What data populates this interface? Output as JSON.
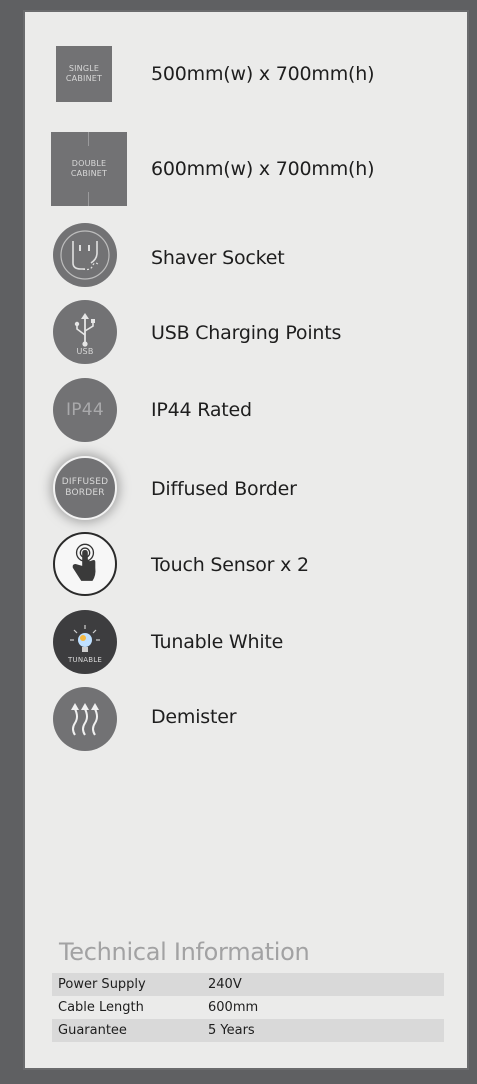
{
  "features": [
    {
      "icon_text": "SINGLE CABINET",
      "icon_name": "single-cabinet-icon",
      "label": "500mm(w) x 700mm(h)"
    },
    {
      "icon_text": "DOUBLE CABINET",
      "icon_name": "double-cabinet-icon",
      "label": "600mm(w) x 700mm(h)"
    },
    {
      "icon_text": "",
      "icon_name": "shaver-socket-icon",
      "label": "Shaver Socket"
    },
    {
      "icon_text": "USB",
      "icon_name": "usb-icon",
      "label": "USB Charging Points"
    },
    {
      "icon_text": "IP44",
      "icon_name": "ip44-icon",
      "label": "IP44 Rated"
    },
    {
      "icon_text": "DIFFUSED BORDER",
      "icon_name": "diffused-border-icon",
      "label": "Diffused Border"
    },
    {
      "icon_text": "",
      "icon_name": "touch-sensor-icon",
      "label": "Touch Sensor x 2"
    },
    {
      "icon_text": "TUNABLE",
      "icon_name": "tunable-white-icon",
      "label": "Tunable White"
    },
    {
      "icon_text": "",
      "icon_name": "demister-icon",
      "label": "Demister"
    }
  ],
  "technical": {
    "title": "Technical Information",
    "rows": [
      {
        "label": "Power Supply",
        "value": "240V"
      },
      {
        "label": "Cable Length",
        "value": "600mm"
      },
      {
        "label": "Guarantee",
        "value": "5 Years"
      }
    ]
  },
  "colors": {
    "page_background": "#5f6062",
    "panel_background": "#ebebea",
    "icon_fill": "#727274",
    "table_shade": "#d9d9d9"
  }
}
